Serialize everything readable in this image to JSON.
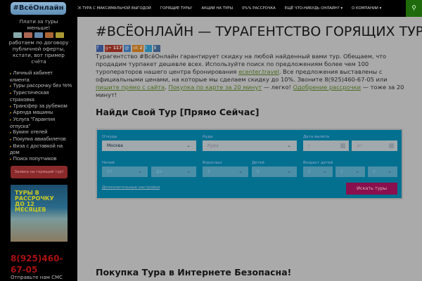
{
  "nav": {
    "items": [
      "Поиск тура с максимальной выгодой",
      "Горящие туры!",
      "Акции на туры",
      "0%% рассрочка",
      "Ещё что-нибудь онлайн? ▾",
      "О компании ▾"
    ]
  },
  "sidebar": {
    "logo": "#ВсёОнлайн",
    "pay_text": "Плати за туры меньше!",
    "contract_text": "работаем по договору публичной оферты, кстати, вот пример счёта",
    "links": [
      "Личный кабинет клиента",
      "Туры рассрочку без %%",
      "Туристическая страховка",
      "Трансфер за рубежом",
      "Аренда машины",
      "Услуга \"Гарантия отпуска\"",
      "Букинг отелей",
      "Покупка авиабилетов",
      "Виза с доставкой на дом",
      "Поиск попутчиков"
    ],
    "hot_button": "Заявка на горящий тур!",
    "banner": "ТУРЫ В РАССРОЧКУ ДО 12 МЕСЯЦЕВ",
    "phone": "8(925)460-67-05",
    "sms": "Отправьте нам СМС"
  },
  "main": {
    "title": "#ВСЁОНЛАЙН — ТУРАГЕНТСТВО ГОРЯЩИХ ТУРОВ",
    "social": {
      "gplus_count": "117",
      "ok_count": "2"
    },
    "intro": {
      "p1": "Турагентство #ВсёОнлайн гарантирует скидку на любой найденный вами тур. Обещаем, что продадим турпакет дешевле всех. Используйте поиск по предложениям более чем 100 туроператоров нашего центра бронирования ",
      "link1": "ecenter.travel",
      "p2": ". Все предложения выставлены с официальными ценами, на которые мы сделаем скидку до 10%. Звоните 8(925)460-67-05 или ",
      "link2": "пишите прямо с сайта",
      "p3": ". ",
      "link3": "Покупка по карте за 20 минут",
      "p4": " — легко! ",
      "link4": "Одобрение рассрочки",
      "p5": " — тоже за 20 минут!"
    },
    "search_heading": "Найди Свой Тур [Прямо Сейчас]",
    "widget": {
      "from_label": "Откуда",
      "from_value": "Москва",
      "to_label": "Куда",
      "to_placeholder": "Куда",
      "date_label": "Дата вылета",
      "date_from": "с",
      "date_to": "до",
      "nights_label": "Ночей",
      "nights_from": "От",
      "nights_to": "До",
      "adults_label": "Взрослых",
      "adults": "2",
      "children_label": "Детей",
      "children": "0",
      "ages_label": "Возраст детей",
      "ages": [
        "2",
        "2",
        "2"
      ],
      "more": "Дополнительные настройки",
      "search_button": "Искать туры"
    },
    "bottom_heading": "Покупка Тура в Интернете Безопасна!"
  }
}
